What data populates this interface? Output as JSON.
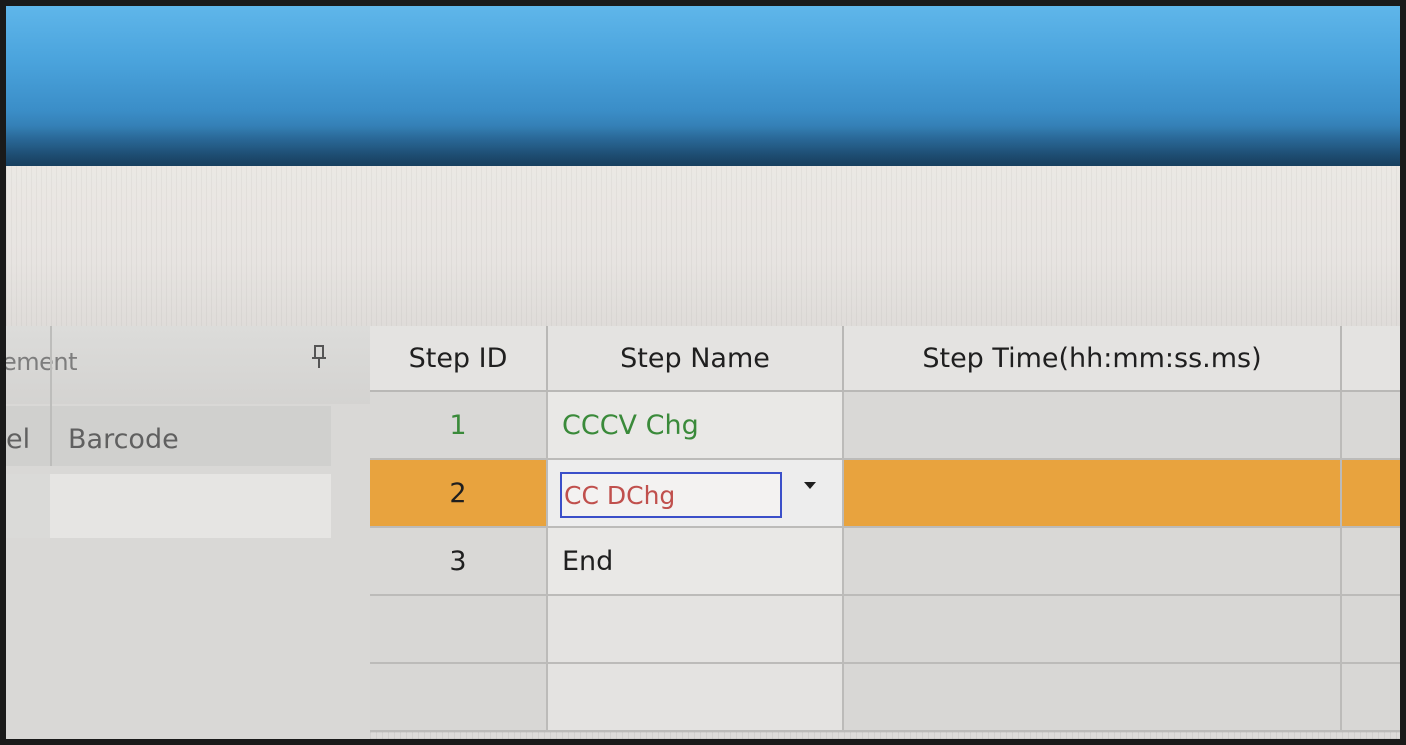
{
  "left_pane": {
    "title": "ement",
    "columns": [
      "el",
      "Barcode"
    ]
  },
  "grid": {
    "headers": [
      "Step ID",
      "Step Name",
      "Step Time(hh:mm:ss.ms)"
    ],
    "rows": [
      {
        "id": "1",
        "name": "CCCV Chg",
        "name_color": "#3a8a3a"
      },
      {
        "id": "2",
        "name": "CC DChg",
        "name_color": "#c0504d",
        "editing": true
      },
      {
        "id": "3",
        "name": "End",
        "name_color": "#1f1f1f"
      }
    ]
  },
  "colors": {
    "selected_row": "#e8a33e",
    "edit_border": "#3b4fc9",
    "titlebar": "#3b8ec8"
  },
  "icons": {
    "pin": "pin-icon",
    "dropdown": "chevron-down-icon"
  }
}
